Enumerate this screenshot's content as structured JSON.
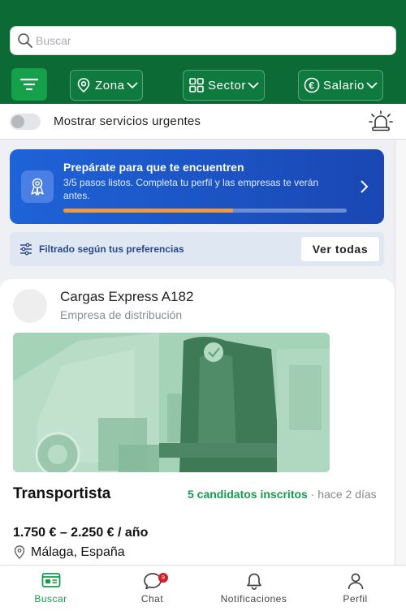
{
  "search": {
    "placeholder": "Buscar"
  },
  "filters": {
    "zona": "Zona",
    "sector": "Sector",
    "salario": "Salario"
  },
  "urgent": {
    "label": "Mostrar servicios urgentes",
    "enabled": false
  },
  "promo": {
    "title": "Prepárate para que te encuentren",
    "description": "3/5 pasos listos. Completa tu perfil y las empresas te verán antes.",
    "progress": 0.6
  },
  "preferences": {
    "label": "Filtrado según tus preferencias",
    "button": "Ver todas"
  },
  "job": {
    "company": "Cargas Express A182",
    "company_type": "Empresa de distribución",
    "title": "Transportista",
    "candidates": "5 candidatos inscritos",
    "separator": "·",
    "posted": "hace 2 días",
    "salary": "1.750 € – 2.250 € / año",
    "location": "Málaga, España"
  },
  "nav": {
    "items": [
      {
        "label": "Buscar",
        "active": true
      },
      {
        "label": "Chat",
        "badge": "9"
      },
      {
        "label": "Notificaciones"
      },
      {
        "label": "Perfil"
      }
    ]
  },
  "colors": {
    "brand": "#0c6b35",
    "accent": "#15a04a",
    "promo": "#1a47b3",
    "progress": "#ef9b3d",
    "badge": "#d11f2a"
  }
}
